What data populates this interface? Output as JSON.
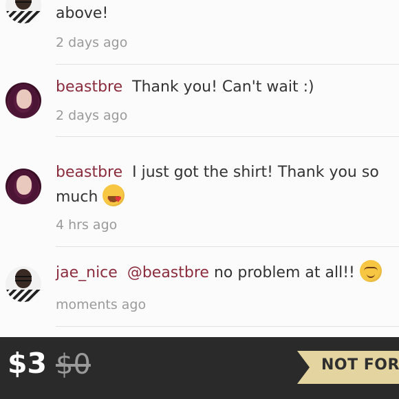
{
  "comments": [
    {
      "username": "",
      "message": "above!",
      "time": "2 days ago"
    },
    {
      "username": "beastbre",
      "message": "Thank you! Can't wait :)",
      "time": "2 days ago"
    },
    {
      "username": "beastbre",
      "message_line1": "I just got the shirt! Thank you so",
      "message_line2": "much",
      "time": "4 hrs ago",
      "emoji": "heart-eyes-emoji"
    },
    {
      "username": "jae_nice",
      "mention": "@beastbre",
      "message": "no problem at all!!",
      "time": "moments ago",
      "emoji": "smiling-blush-emoji"
    }
  ],
  "listing": {
    "price": "$3",
    "original_price": "$0",
    "status_label": "NOT FOR"
  },
  "colors": {
    "username": "#8b2c3d",
    "bottom_bar": "#2a2a2a",
    "ribbon": "#e3d4a0"
  }
}
